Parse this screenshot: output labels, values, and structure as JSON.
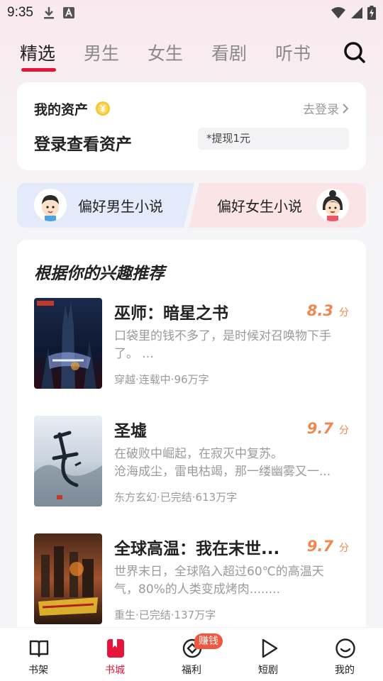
{
  "status_bar": {
    "time": "9:35"
  },
  "top_tabs": [
    {
      "label": "精选",
      "active": true
    },
    {
      "label": "男生",
      "active": false
    },
    {
      "label": "女生",
      "active": false
    },
    {
      "label": "看剧",
      "active": false
    },
    {
      "label": "听书",
      "active": false
    }
  ],
  "assets": {
    "title": "我的资产",
    "login_link": "去登录",
    "subtitle": "登录查看资产",
    "withdraw": "*提现1元"
  },
  "preference": {
    "male": "偏好男生小说",
    "female": "偏好女生小说"
  },
  "recommend": {
    "title": "根据你的兴趣推荐",
    "books": [
      {
        "title": "巫师：暗星之书",
        "score": "8.3",
        "unit": "分",
        "desc_line1": "口袋里的钱不多了，是时候对召唤物下手",
        "desc_line2": "了。 ...",
        "meta": "穿越·连载中·96万字"
      },
      {
        "title": "圣墟",
        "score": "9.7",
        "unit": "分",
        "desc_line1": "在破败中崛起，在寂灭中复苏。",
        "desc_line2": "沧海成尘，雷电枯竭，那一缕幽雾又一...",
        "meta": "东方玄幻·已完结·613万字"
      },
      {
        "title": "全球高温：我在末世...",
        "score": "9.7",
        "unit": "分",
        "desc_line1": "世界末日，全球陷入超过60℃的高温天",
        "desc_line2": "气，80%的人类变成烤肉........",
        "meta": "重生·已完结·137万字"
      }
    ]
  },
  "bottom_nav": {
    "items": [
      {
        "label": "书架"
      },
      {
        "label": "书城"
      },
      {
        "label": "福利"
      },
      {
        "label": "短剧"
      },
      {
        "label": "我的"
      }
    ],
    "earn_badge": "赚钱"
  },
  "colors": {
    "accent": "#e6133a",
    "score": "#f0874f",
    "male_bg": "#e3ebfb",
    "female_bg": "#fbe4e6"
  }
}
